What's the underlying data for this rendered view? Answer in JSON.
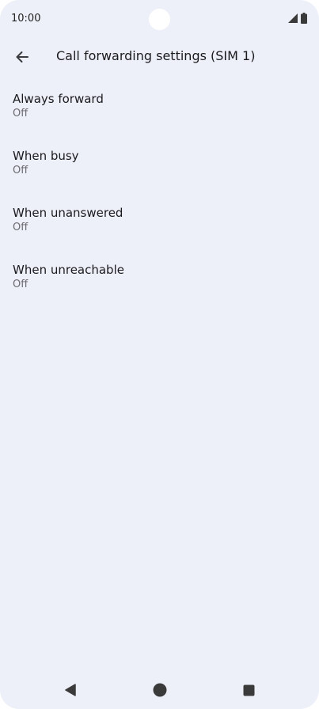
{
  "status_bar": {
    "time": "10:00",
    "icons": [
      "cellular-signal-icon",
      "battery-icon"
    ]
  },
  "app_bar": {
    "title": "Call forwarding settings (SIM 1)",
    "back_icon": "arrow-left-icon"
  },
  "settings": [
    {
      "title": "Always forward",
      "summary": "Off"
    },
    {
      "title": "When busy",
      "summary": "Off"
    },
    {
      "title": "When unanswered",
      "summary": "Off"
    },
    {
      "title": "When unreachable",
      "summary": "Off"
    }
  ],
  "nav_bar": {
    "buttons": [
      "back-triangle-icon",
      "home-circle-icon",
      "recents-square-icon"
    ]
  },
  "colors": {
    "background": "#edf0f8",
    "text_primary": "#1b1b1f",
    "text_secondary": "#6a6a70"
  }
}
